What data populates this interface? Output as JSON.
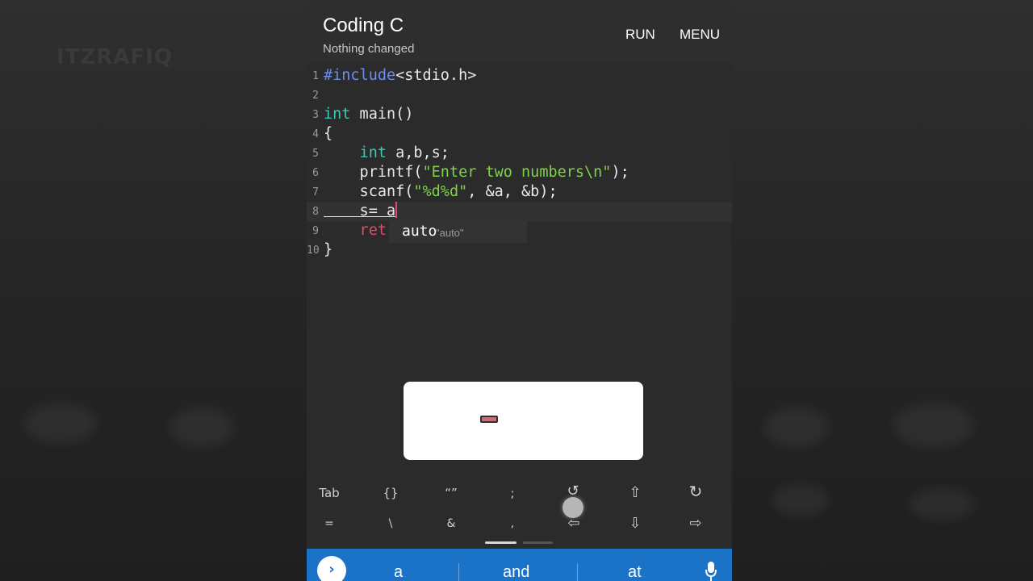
{
  "watermark": "ITZRAFIQ",
  "appbar": {
    "title": "Coding C",
    "subtitle": "Nothing changed",
    "run_label": "RUN",
    "menu_label": "MENU"
  },
  "editor": {
    "line_numbers": [
      "1",
      "2",
      "3",
      "4",
      "5",
      "6",
      "7",
      "8",
      "9",
      "10"
    ],
    "lines": {
      "l1_directive": "#include",
      "l1_rest": "<stdio.h>",
      "l3_type": "int",
      "l3_rest": " main()",
      "l4": "{",
      "l5_indent": "    ",
      "l5_type": "int",
      "l5_rest": " a,b,s;",
      "l6_head": "    printf(",
      "l6_str": "\"Enter two numbers\\n\"",
      "l6_tail": ");",
      "l7_head": "    scanf(",
      "l7_str": "\"%d%d\"",
      "l7_tail": ", &a, &b);",
      "l8_text": "    s= a",
      "l9_partial": "    ret",
      "l10": "}"
    },
    "autocomplete": {
      "word": "auto",
      "hint": "\"auto\""
    }
  },
  "toolbar": {
    "row1": [
      "Tab",
      "{}",
      "“”",
      ";",
      "↺",
      "⇧",
      "↻"
    ],
    "row2": [
      "=",
      "\\",
      "&",
      ",",
      "⇦",
      "⇩",
      "⇨"
    ]
  },
  "suggestions": {
    "words": [
      "a",
      "and",
      "at"
    ]
  },
  "colors": {
    "keyword": "#3fc9b0",
    "directive": "#6c8df0",
    "string": "#7fd34a",
    "suggestion_bar": "#1a73c7"
  },
  "icons": [
    "chevron-right-icon",
    "microphone-icon",
    "undo-icon",
    "redo-icon",
    "arrow-up-icon",
    "arrow-down-icon",
    "arrow-left-icon",
    "arrow-right-icon"
  ]
}
